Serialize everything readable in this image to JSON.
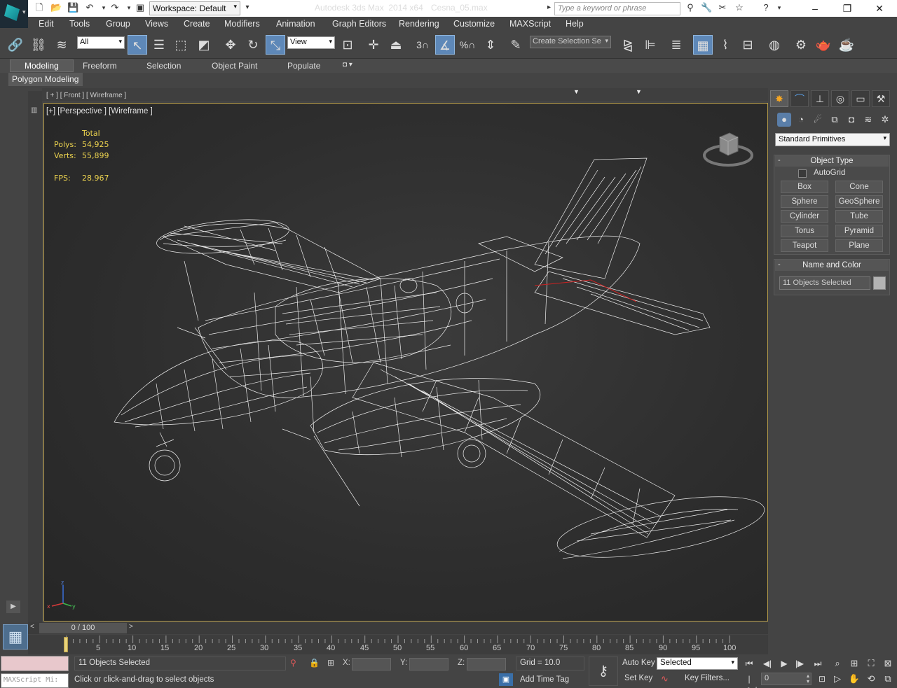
{
  "app": {
    "title": "Autodesk 3ds Max  2014 x64",
    "file": "Cesna_05.max",
    "workspace": "Workspace: Default",
    "search_placeholder": "Type a keyword or phrase"
  },
  "menu": [
    "Edit",
    "Tools",
    "Group",
    "Views",
    "Create",
    "Modifiers",
    "Animation",
    "Graph Editors",
    "Rendering",
    "Customize",
    "MAXScript",
    "Help"
  ],
  "toolbar": {
    "selection_filter": "All",
    "ref_coord": "View",
    "named_selection_placeholder": "Create Selection Se",
    "snap_label": "3",
    "percent_snap_label": "%"
  },
  "ribbon": {
    "tabs": [
      "Modeling",
      "Freeform",
      "Selection",
      "Object Paint",
      "Populate"
    ],
    "active_tab": "Modeling",
    "panel": "Polygon Modeling"
  },
  "viewport": {
    "top_label": "[ + ] [ Front ] [ Wireframe ]",
    "label": "[+] [Perspective ] [Wireframe ]",
    "stats": {
      "header": "Total",
      "polys_label": "Polys:",
      "polys": "54,925",
      "verts_label": "Verts:",
      "verts": "55,899",
      "fps_label": "FPS:",
      "fps": "28.967"
    },
    "colors": {
      "border": "#b59b49",
      "stats": "#ecd34f",
      "wire": "#ffffff"
    }
  },
  "command_panel": {
    "category": "Standard Primitives",
    "object_type_title": "Object Type",
    "autogrid": "AutoGrid",
    "buttons": [
      "Box",
      "Cone",
      "Sphere",
      "GeoSphere",
      "Cylinder",
      "Tube",
      "Torus",
      "Pyramid",
      "Teapot",
      "Plane"
    ],
    "name_color_title": "Name and Color",
    "name_value": "11 Objects Selected"
  },
  "timeline": {
    "counter": "0 / 100",
    "ticks": [
      "5",
      "10",
      "15",
      "20",
      "25",
      "30",
      "35",
      "40",
      "45",
      "50",
      "55",
      "60",
      "65",
      "70",
      "75",
      "80",
      "85",
      "90",
      "95",
      "100"
    ]
  },
  "status": {
    "selected": "11 Objects Selected",
    "prompt": "Click or click-and-drag to select objects",
    "x_label": "X:",
    "y_label": "Y:",
    "z_label": "Z:",
    "grid": "Grid = 10.0",
    "add_time_tag": "Add Time Tag",
    "auto_key": "Auto Key",
    "set_key": "Set Key",
    "selected_dd": "Selected",
    "key_filters": "Key Filters...",
    "frame": "0",
    "maxscript": "MAXScript Mi:"
  }
}
